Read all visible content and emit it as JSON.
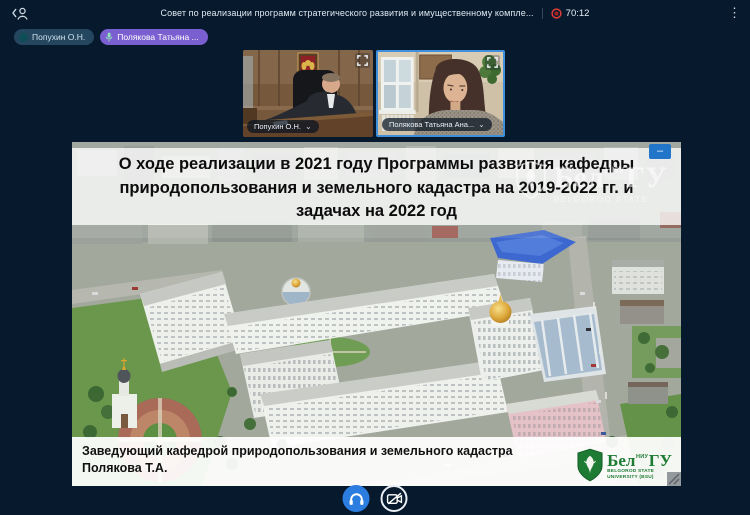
{
  "topbar": {
    "meeting_title": "Совет по реализации программ стратегического развития и имущественному компле...",
    "recording_time": "70:12"
  },
  "icons": {
    "kebab": "⋮",
    "chevron_down": "⌄",
    "minimize": "–"
  },
  "talking_indicators": [
    {
      "name": "Попухин О.Н."
    },
    {
      "name": "Полякова Татьяна ..."
    }
  ],
  "videos": [
    {
      "label": "Попухин О.Н."
    },
    {
      "label": "Полякова Татьяна Ана..."
    }
  ],
  "slide": {
    "title_lines": [
      "О ходе реализации в 2021 году Программы развития кафедры",
      "природопользования и земельного кадастра на 2019-2022 гг. и",
      "задачах на 2022 год"
    ],
    "caption_lines": [
      "Заведующий кафедрой природопользования и земельного кадастра",
      "Полякова Т.А."
    ],
    "logo": {
      "prefix": "Бел",
      "suffix": "ГУ",
      "niu": "НИУ",
      "line1": "BELGOROD STATE",
      "line2": "UNIVERSITY (BSU)"
    }
  },
  "colors": {
    "background": "#071a2d",
    "primary_blue": "#2b7de0",
    "active_speaker_border": "#3f8fdc",
    "talking_pill": "#7a5fd0",
    "muted_pill": "#24465f",
    "recording_red": "#e23b3b",
    "university_green": "#1e7b34"
  }
}
